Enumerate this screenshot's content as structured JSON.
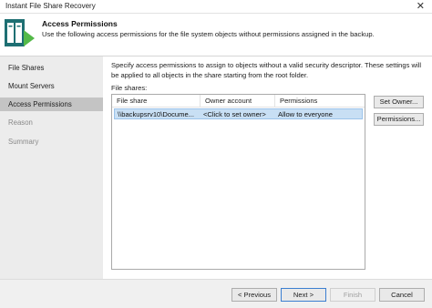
{
  "window": {
    "title": "Instant File Share Recovery",
    "close_glyph": "✕"
  },
  "header": {
    "title": "Access Permissions",
    "description": "Use the following access permissions for the file system objects without permissions assigned in the backup."
  },
  "sidebar": {
    "items": [
      {
        "label": "File Shares",
        "state": "normal"
      },
      {
        "label": "Mount Servers",
        "state": "normal"
      },
      {
        "label": "Access Permissions",
        "state": "active"
      },
      {
        "label": "Reason",
        "state": "disabled"
      },
      {
        "label": "Summary",
        "state": "disabled"
      }
    ]
  },
  "main": {
    "instruction": "Specify access permissions to assign to objects without a valid security descriptor. These settings will be applied to all objects in the share starting from the root folder.",
    "file_shares_label": "File shares:",
    "table": {
      "columns": [
        "File share",
        "Owner account",
        "Permissions"
      ],
      "rows": [
        [
          "\\\\backupsrv10\\Docume...",
          "<Click to set owner>",
          "Allow to everyone"
        ]
      ]
    },
    "set_owner_button": "Set Owner...",
    "permissions_button": "Permissions..."
  },
  "footer": {
    "previous": "< Previous",
    "next": "Next >",
    "finish": "Finish",
    "cancel": "Cancel"
  },
  "colors": {
    "accent_green": "#54b948",
    "logo_teal": "#1e6f73",
    "selection_blue": "#c8dff4",
    "sidebar_bg": "#ececec",
    "sidebar_active": "#c4c4c4"
  },
  "icons": {
    "wizard_logo": "file-share-recovery-icon"
  }
}
